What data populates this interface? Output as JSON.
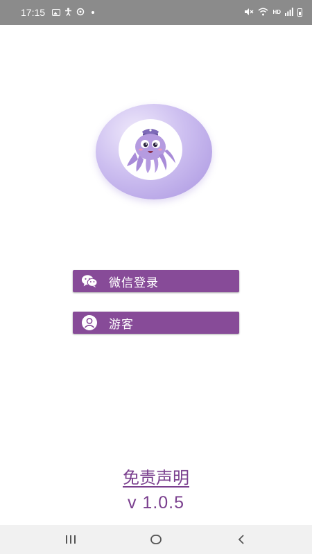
{
  "status_bar": {
    "time": "17:15",
    "network_label": "HD",
    "icons": [
      "image-icon",
      "accessibility-icon",
      "sync-icon",
      "dot-icon",
      "mute-icon",
      "wifi-icon",
      "signal-icon",
      "battery-icon"
    ]
  },
  "logo": {
    "icon": "octopus-mascot-icon",
    "colors": {
      "ring": "#b8a6e8",
      "body": "#b59be0"
    }
  },
  "buttons": {
    "wechat_login": {
      "label": "微信登录",
      "icon": "wechat-icon"
    },
    "guest": {
      "label": "游客",
      "icon": "user-icon"
    }
  },
  "footer": {
    "disclaimer": "免责声明",
    "version": "v 1.0.5"
  },
  "nav_bar": {
    "buttons": [
      "recents-icon",
      "home-icon",
      "back-icon"
    ]
  },
  "colors": {
    "accent": "#874b98",
    "link": "#7a3f8e",
    "status_bar": "#8b8b8b"
  }
}
